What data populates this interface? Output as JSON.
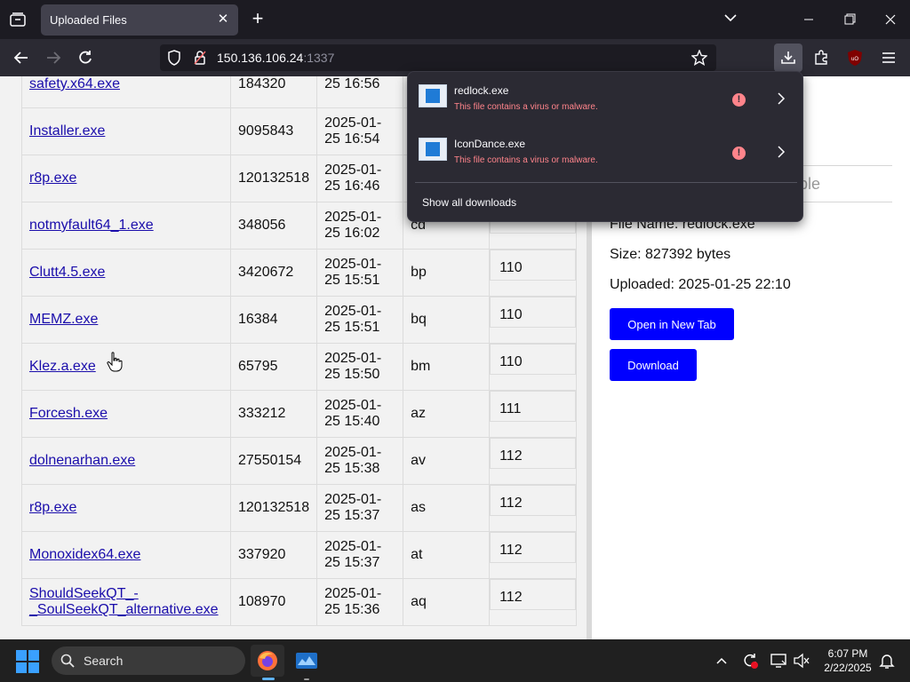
{
  "browser": {
    "tab_title": "Uploaded Files",
    "url_host": "150.136.106.24",
    "url_port": ":1337"
  },
  "file_rows": [
    {
      "name": "safety.x64.exe",
      "size": "184320",
      "date1": "",
      "date2": "25 16:56",
      "code": "",
      "num": ""
    },
    {
      "name": "Installer.exe",
      "size": "9095843",
      "date1": "2025-01-",
      "date2": "25 16:54",
      "code": "",
      "num": ""
    },
    {
      "name": "r8p.exe",
      "size": "120132518",
      "date1": "2025-01-",
      "date2": "25 16:46",
      "code": "",
      "num": ""
    },
    {
      "name": "notmyfault64_1.exe",
      "size": "348056",
      "date1": "2025-01-",
      "date2": "25 16:02",
      "code": "cd",
      "num": ""
    },
    {
      "name": "Clutt4.5.exe",
      "size": "3420672",
      "date1": "2025-01-",
      "date2": "25 15:51",
      "code": "bp",
      "num": "110"
    },
    {
      "name": "MEMZ.exe",
      "size": "16384",
      "date1": "2025-01-",
      "date2": "25 15:51",
      "code": "bq",
      "num": "110"
    },
    {
      "name": "Klez.a.exe",
      "size": "65795",
      "date1": "2025-01-",
      "date2": "25 15:50",
      "code": "bm",
      "num": "110"
    },
    {
      "name": "Forcesh.exe",
      "size": "333212",
      "date1": "2025-01-",
      "date2": "25 15:40",
      "code": "az",
      "num": "111"
    },
    {
      "name": "dolnenarhan.exe",
      "size": "27550154",
      "date1": "2025-01-",
      "date2": "25 15:38",
      "code": "av",
      "num": "112"
    },
    {
      "name": "r8p.exe",
      "size": "120132518",
      "date1": "2025-01-",
      "date2": "25 15:37",
      "code": "as",
      "num": "112"
    },
    {
      "name": "Monoxidex64.exe",
      "size": "337920",
      "date1": "2025-01-",
      "date2": "25 15:37",
      "code": "at",
      "num": "112"
    },
    {
      "name": "ShouldSeekQT_-\n_SoulSeekQT_alternative.exe",
      "size": "108970",
      "date1": "2025-01-",
      "date2": "25 15:36",
      "code": "aq",
      "num": "112"
    }
  ],
  "details": {
    "search_placeholder_fragment": "ble",
    "file_name": "File Name: redlock.exe",
    "size": "Size: 827392 bytes",
    "uploaded": "Uploaded: 2025-01-25 22:10",
    "open_button": "Open in New Tab",
    "download_button": "Download"
  },
  "downloads_panel": {
    "items": [
      {
        "name": "redlock.exe",
        "warning": "This file contains a virus or malware."
      },
      {
        "name": "IconDance.exe",
        "warning": "This file contains a virus or malware."
      }
    ],
    "show_all": "Show all downloads"
  },
  "taskbar": {
    "search_label": "Search",
    "time": "6:07 PM",
    "date": "2/22/2025"
  }
}
